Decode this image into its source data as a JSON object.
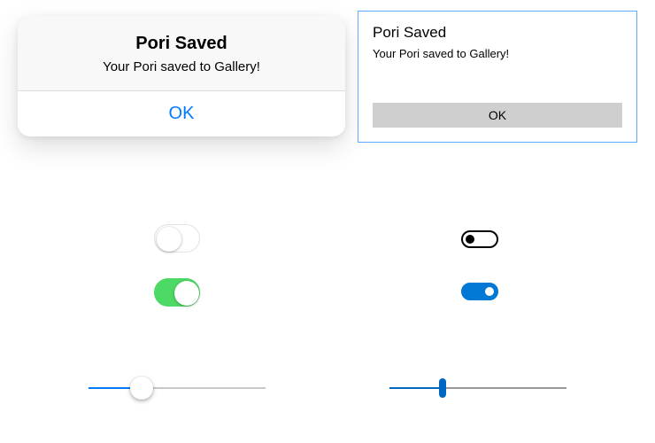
{
  "ios_alert": {
    "title": "Pori Saved",
    "message": "Your Pori saved to Gallery!",
    "ok_label": "OK"
  },
  "win_alert": {
    "title": "Pori Saved",
    "message": "Your Pori saved to Gallery!",
    "ok_label": "OK"
  },
  "toggles": {
    "ios_off": false,
    "ios_on": true,
    "uwp_off": false,
    "uwp_on": true
  },
  "sliders": {
    "ios": {
      "value": 30,
      "min": 0,
      "max": 100
    },
    "uwp": {
      "value": 30,
      "min": 0,
      "max": 100
    }
  },
  "colors": {
    "ios_accent": "#007aff",
    "ios_green": "#4cd964",
    "uwp_accent": "#0078d4"
  }
}
